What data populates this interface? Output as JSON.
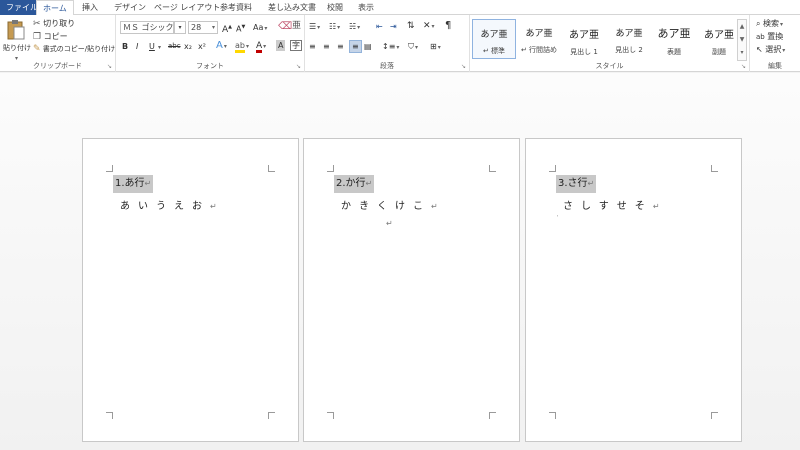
{
  "tabs": [
    {
      "label": "ファイル",
      "state": "file"
    },
    {
      "label": "ホーム",
      "state": "active"
    },
    {
      "label": "挿入",
      "state": ""
    },
    {
      "label": "デザイン",
      "state": ""
    },
    {
      "label": "ページ レイアウト",
      "state": ""
    },
    {
      "label": "参考資料",
      "state": ""
    },
    {
      "label": "差し込み文書",
      "state": ""
    },
    {
      "label": "校閲",
      "state": ""
    },
    {
      "label": "表示",
      "state": ""
    }
  ],
  "clipboard": {
    "paste": "貼り付け",
    "cut": "切り取り",
    "copy": "コピー",
    "format_painter": "書式のコピー/貼り付け",
    "label": "クリップボード"
  },
  "font": {
    "name": "ＭＳ ゴシック (",
    "size": "28",
    "grow": "A",
    "shrink": "A",
    "case": "Aa",
    "bold": "B",
    "italic": "I",
    "underline": "U",
    "strike": "abc",
    "subscript": "x₂",
    "superscript": "x²",
    "effects": "A",
    "color": "A",
    "char_shading": "A",
    "label": "フォント"
  },
  "paragraph": {
    "label": "段落"
  },
  "styles": {
    "label": "スタイル",
    "items": [
      {
        "preview": "あア亜",
        "name": "↵ 標準"
      },
      {
        "preview": "あア亜",
        "name": "↵ 行間詰め"
      },
      {
        "preview": "あア亜",
        "name": "見出し 1"
      },
      {
        "preview": "あア亜",
        "name": "見出し 2"
      },
      {
        "preview": "あア亜",
        "name": "表題"
      },
      {
        "preview": "あア亜",
        "name": "副題"
      }
    ]
  },
  "editing": {
    "find": "検索",
    "replace": "置換",
    "select": "選択",
    "label": "編集"
  },
  "pages": [
    {
      "heading": "1.あ行",
      "mark": "↵",
      "kana": "あいうえお",
      "extra_mark": ""
    },
    {
      "heading": "2.か行",
      "mark": "↵",
      "kana": "かきくけこ",
      "extra_mark": "↵"
    },
    {
      "heading": "3.さ行",
      "mark": "↵",
      "kana": "さしすせそ",
      "extra_mark": ""
    }
  ],
  "colors": {
    "file_tab": "#2b579a",
    "highlight": "#c8c8c8",
    "accent_red": "#c00000",
    "accent_yellow": "#ffd800"
  }
}
